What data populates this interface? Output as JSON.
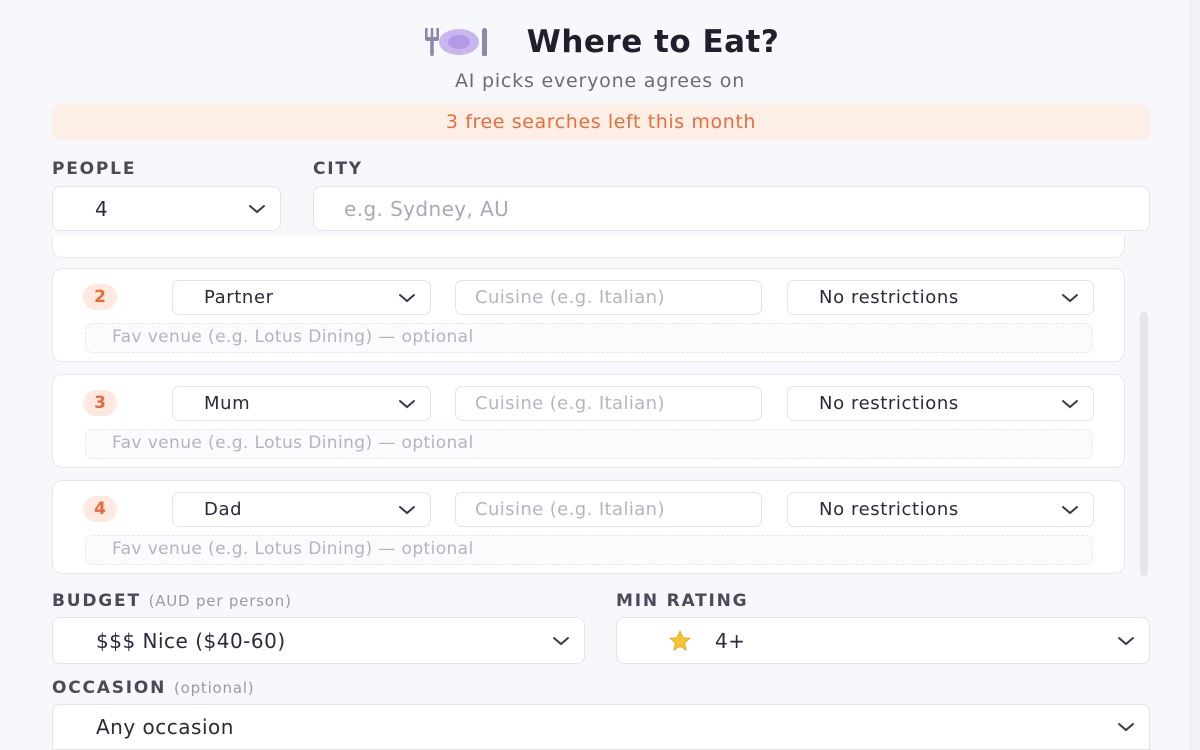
{
  "header": {
    "title": "Where to Eat?",
    "subtitle": "AI picks everyone agrees on",
    "icon": "plate-fork-knife-icon"
  },
  "banner": {
    "text": "3 free searches left this month"
  },
  "people": {
    "label": "PEOPLE",
    "value": "4"
  },
  "city": {
    "label": "CITY",
    "placeholder": "e.g. Sydney, AU"
  },
  "members": [
    {
      "number": "2",
      "who": "Partner",
      "cuisine_placeholder": "Cuisine (e.g. Italian)",
      "diet": "No restrictions",
      "fav_placeholder": "Fav venue (e.g. Lotus Dining) — optional"
    },
    {
      "number": "3",
      "who": "Mum",
      "cuisine_placeholder": "Cuisine (e.g. Italian)",
      "diet": "No restrictions",
      "fav_placeholder": "Fav venue (e.g. Lotus Dining) — optional"
    },
    {
      "number": "4",
      "who": "Dad",
      "cuisine_placeholder": "Cuisine (e.g. Italian)",
      "diet": "No restrictions",
      "fav_placeholder": "Fav venue (e.g. Lotus Dining) — optional"
    }
  ],
  "budget": {
    "label": "BUDGET",
    "hint": "(AUD per person)",
    "value": "$$$ Nice ($40-60)"
  },
  "rating": {
    "label": "MIN RATING",
    "value": "4+",
    "icon": "star-icon"
  },
  "occasion": {
    "label": "OCCASION",
    "hint": "(optional)",
    "value": "Any occasion"
  },
  "colors": {
    "accent": "#e86d3a",
    "banner_bg": "#fdeee6",
    "badge_bg": "#fde9df",
    "plate": "#c9b6ee"
  }
}
